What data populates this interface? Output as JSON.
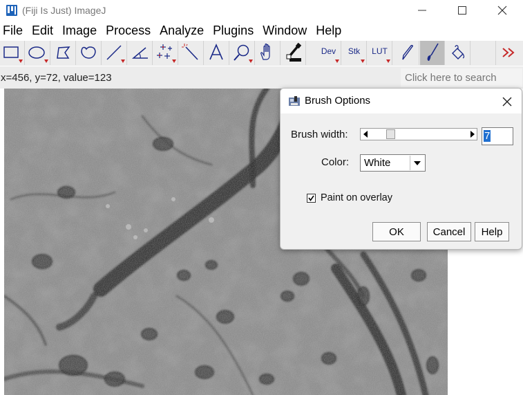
{
  "window": {
    "title": "(Fiji Is Just) ImageJ",
    "icons": [
      "app-logo-icon",
      "minimize-icon",
      "maximize-icon",
      "close-icon"
    ]
  },
  "menubar": {
    "items": [
      "File",
      "Edit",
      "Image",
      "Process",
      "Analyze",
      "Plugins",
      "Window",
      "Help"
    ]
  },
  "toolbar": {
    "tools": [
      {
        "name": "rectangle-tool",
        "icon": "rectangle-icon"
      },
      {
        "name": "oval-tool",
        "icon": "oval-icon"
      },
      {
        "name": "polygon-tool",
        "icon": "polygon-icon"
      },
      {
        "name": "freehand-tool",
        "icon": "freehand-icon"
      },
      {
        "name": "line-tool",
        "icon": "line-icon"
      },
      {
        "name": "angle-tool",
        "icon": "angle-icon"
      },
      {
        "name": "point-tool",
        "icon": "multipoint-icon"
      },
      {
        "name": "wand-tool",
        "icon": "wand-icon"
      },
      {
        "name": "text-tool",
        "icon": "text-a-icon"
      },
      {
        "name": "zoom-tool",
        "icon": "magnifier-icon"
      },
      {
        "name": "hand-tool",
        "icon": "hand-icon"
      },
      {
        "name": "dropper-tool",
        "icon": "color-picker-icon"
      }
    ],
    "dev_label": "Dev",
    "stk_label": "Stk",
    "lut_label": "LUT",
    "extra_tools": [
      "pencil-icon",
      "paintbrush-icon",
      "flood-fill-icon"
    ],
    "more_icon": "double-chevron-right-icon",
    "selected_tool": "paintbrush",
    "accent_red": "#c62828",
    "accent_blue": "#1b2a88"
  },
  "status": {
    "coords": "x=456, y=72, value=123",
    "search_placeholder": "Click here to search"
  },
  "dialog": {
    "title": "Brush Options",
    "brush_width_label": "Brush width:",
    "brush_width_value": "7",
    "color_label": "Color:",
    "color_value": "White",
    "paint_overlay_label": "Paint on overlay",
    "paint_overlay_checked": true,
    "ok_label": "OK",
    "cancel_label": "Cancel",
    "help_label": "Help"
  }
}
